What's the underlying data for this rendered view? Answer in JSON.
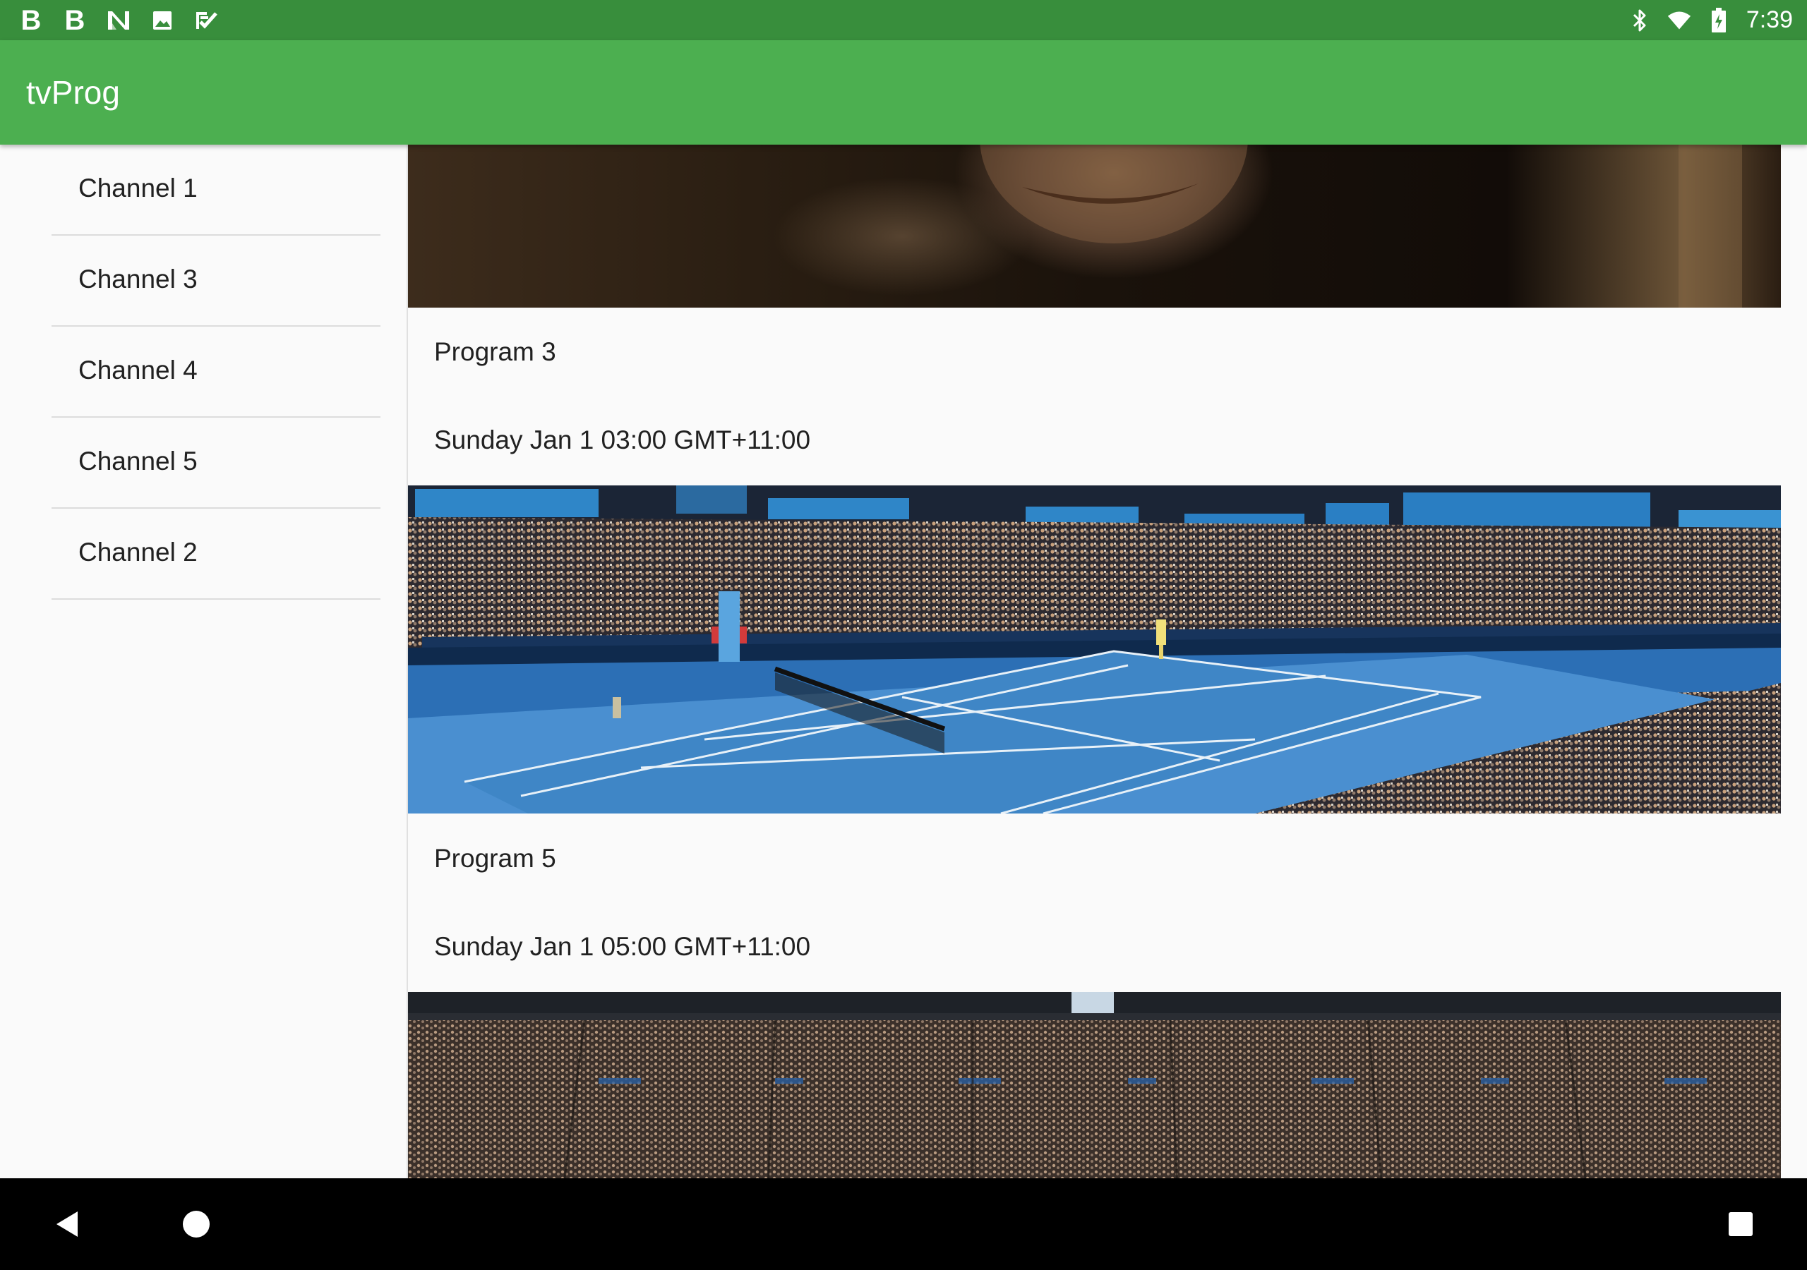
{
  "status_bar": {
    "left_icons": [
      "bold-b-icon",
      "bold-b-icon",
      "n-logo-icon",
      "image-icon",
      "checklist-icon"
    ],
    "right_icons": [
      "bluetooth-icon",
      "wifi-icon",
      "battery-charging-icon"
    ],
    "time": "7:39"
  },
  "app_bar": {
    "title": "tvProg"
  },
  "sidebar": {
    "channels": [
      {
        "label": "Channel 1"
      },
      {
        "label": "Channel 3"
      },
      {
        "label": "Channel 4"
      },
      {
        "label": "Channel 5"
      },
      {
        "label": "Channel 2"
      }
    ]
  },
  "programs": [
    {
      "image": "portrait-thumbnail",
      "title": "Program 3",
      "time": "Sunday Jan 1 03:00 GMT+11:00"
    },
    {
      "image": "tennis-court-thumbnail",
      "title": "Program 5",
      "time": "Sunday Jan 1 05:00 GMT+11:00"
    },
    {
      "image": "stadium-crowd-thumbnail"
    }
  ],
  "nav_bar": {
    "back": "back-icon",
    "home": "home-icon",
    "recents": "recents-icon"
  },
  "colors": {
    "status_bar": "#388e3c",
    "app_bar": "#4caf50",
    "nav_bar": "#000000",
    "background": "#fafafa"
  }
}
